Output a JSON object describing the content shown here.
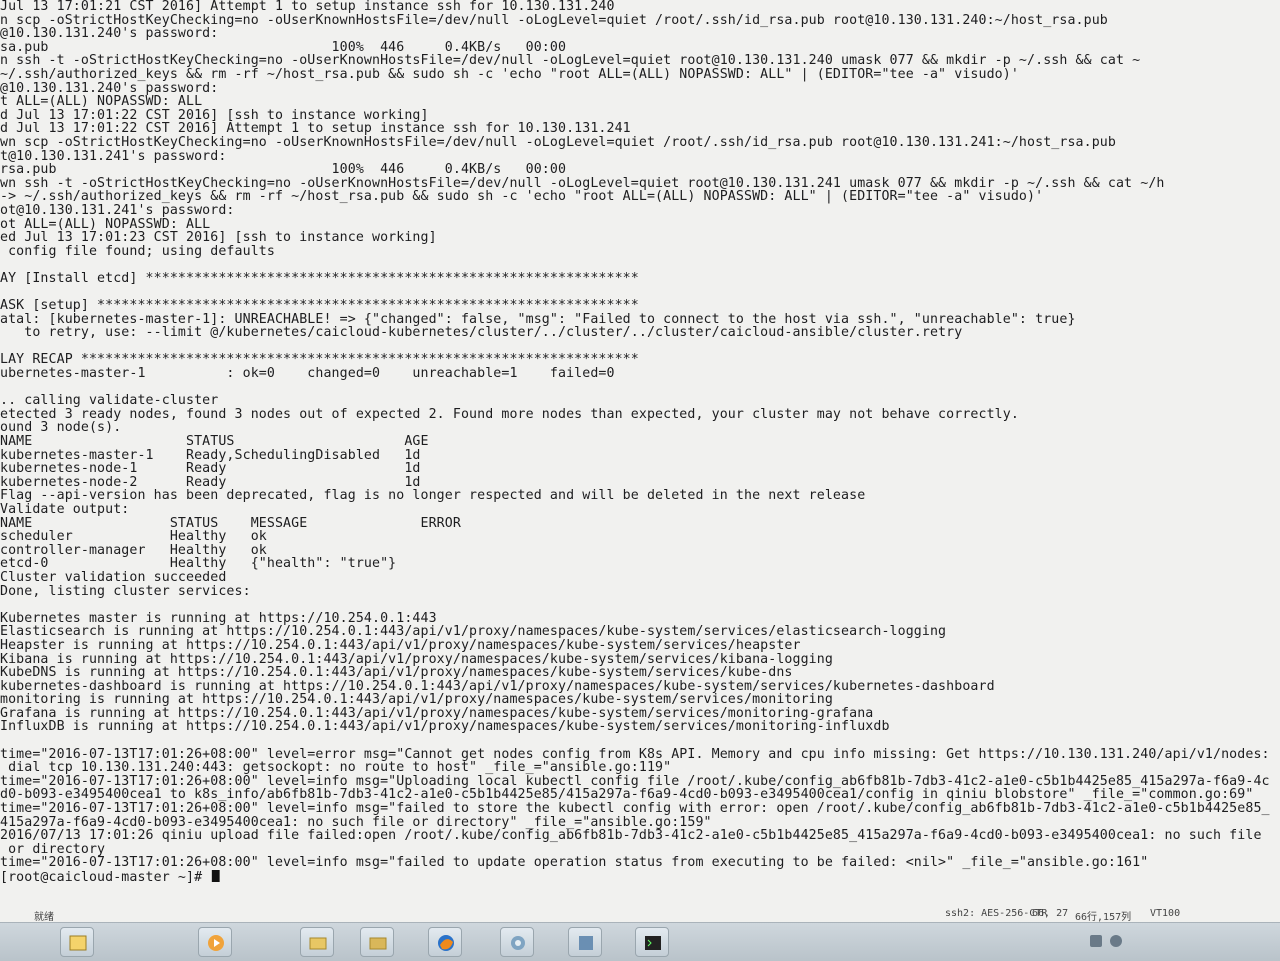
{
  "terminal": {
    "lines": [
      "Jul 13 17:01:21 CST 2016] Attempt 1 to setup instance ssh for 10.130.131.240",
      "n scp -oStrictHostKeyChecking=no -oUserKnownHostsFile=/dev/null -oLogLevel=quiet /root/.ssh/id_rsa.pub root@10.130.131.240:~/host_rsa.pub",
      "@10.130.131.240's password:",
      "sa.pub                                   100%  446     0.4KB/s   00:00",
      "n ssh -t -oStrictHostKeyChecking=no -oUserKnownHostsFile=/dev/null -oLogLevel=quiet root@10.130.131.240 umask 077 && mkdir -p ~/.ssh && cat ~",
      "~/.ssh/authorized_keys && rm -rf ~/host_rsa.pub && sudo sh -c 'echo \"root ALL=(ALL) NOPASSWD: ALL\" | (EDITOR=\"tee -a\" visudo)'",
      "@10.130.131.240's password:",
      "t ALL=(ALL) NOPASSWD: ALL",
      "d Jul 13 17:01:22 CST 2016] [ssh to instance working]",
      "d Jul 13 17:01:22 CST 2016] Attempt 1 to setup instance ssh for 10.130.131.241",
      "wn scp -oStrictHostKeyChecking=no -oUserKnownHostsFile=/dev/null -oLogLevel=quiet /root/.ssh/id_rsa.pub root@10.130.131.241:~/host_rsa.pub",
      "t@10.130.131.241's password:",
      "rsa.pub                                  100%  446     0.4KB/s   00:00",
      "wn ssh -t -oStrictHostKeyChecking=no -oUserKnownHostsFile=/dev/null -oLogLevel=quiet root@10.130.131.241 umask 077 && mkdir -p ~/.ssh && cat ~/h",
      "-> ~/.ssh/authorized_keys && rm -rf ~/host_rsa.pub && sudo sh -c 'echo \"root ALL=(ALL) NOPASSWD: ALL\" | (EDITOR=\"tee -a\" visudo)'",
      "ot@10.130.131.241's password:",
      "ot ALL=(ALL) NOPASSWD: ALL",
      "ed Jul 13 17:01:23 CST 2016] [ssh to instance working]",
      " config file found; using defaults",
      "",
      "AY [Install etcd] *************************************************************",
      "",
      "ASK [setup] *******************************************************************",
      "atal: [kubernetes-master-1]: UNREACHABLE! => {\"changed\": false, \"msg\": \"Failed to connect to the host via ssh.\", \"unreachable\": true}",
      "   to retry, use: --limit @/kubernetes/caicloud-kubernetes/cluster/../cluster/../cluster/caicloud-ansible/cluster.retry",
      "",
      "LAY RECAP *********************************************************************",
      "ubernetes-master-1          : ok=0    changed=0    unreachable=1    failed=0",
      "",
      ".. calling validate-cluster",
      "etected 3 ready nodes, found 3 nodes out of expected 2. Found more nodes than expected, your cluster may not behave correctly.",
      "ound 3 node(s).",
      "NAME                   STATUS                     AGE",
      "kubernetes-master-1    Ready,SchedulingDisabled   1d",
      "kubernetes-node-1      Ready                      1d",
      "kubernetes-node-2      Ready                      1d",
      "Flag --api-version has been deprecated, flag is no longer respected and will be deleted in the next release",
      "Validate output:",
      "NAME                 STATUS    MESSAGE              ERROR",
      "scheduler            Healthy   ok",
      "controller-manager   Healthy   ok",
      "etcd-0               Healthy   {\"health\": \"true\"}",
      "Cluster validation succeeded",
      "Done, listing cluster services:",
      "",
      "Kubernetes master is running at https://10.254.0.1:443",
      "Elasticsearch is running at https://10.254.0.1:443/api/v1/proxy/namespaces/kube-system/services/elasticsearch-logging",
      "Heapster is running at https://10.254.0.1:443/api/v1/proxy/namespaces/kube-system/services/heapster",
      "Kibana is running at https://10.254.0.1:443/api/v1/proxy/namespaces/kube-system/services/kibana-logging",
      "KubeDNS is running at https://10.254.0.1:443/api/v1/proxy/namespaces/kube-system/services/kube-dns",
      "kubernetes-dashboard is running at https://10.254.0.1:443/api/v1/proxy/namespaces/kube-system/services/kubernetes-dashboard",
      "monitoring is running at https://10.254.0.1:443/api/v1/proxy/namespaces/kube-system/services/monitoring",
      "Grafana is running at https://10.254.0.1:443/api/v1/proxy/namespaces/kube-system/services/monitoring-grafana",
      "InfluxDB is running at https://10.254.0.1:443/api/v1/proxy/namespaces/kube-system/services/monitoring-influxdb",
      "",
      "time=\"2016-07-13T17:01:26+08:00\" level=error msg=\"Cannot get nodes config from K8s API. Memory and cpu info missing: Get https://10.130.131.240/api/v1/nodes:",
      " dial tcp 10.130.131.240:443: getsockopt: no route to host\" _file_=\"ansible.go:119\"",
      "time=\"2016-07-13T17:01:26+08:00\" level=info msg=\"Uploading local kubectl config file /root/.kube/config_ab6fb81b-7db3-41c2-a1e0-c5b1b4425e85_415a297a-f6a9-4c",
      "d0-b093-e3495400cea1 to k8s_info/ab6fb81b-7db3-41c2-a1e0-c5b1b4425e85/415a297a-f6a9-4cd0-b093-e3495400cea1/config in qiniu blobstore\" _file_=\"common.go:69\"",
      "time=\"2016-07-13T17:01:26+08:00\" level=info msg=\"failed to store the kubectl config with error: open /root/.kube/config_ab6fb81b-7db3-41c2-a1e0-c5b1b4425e85_",
      "415a297a-f6a9-4cd0-b093-e3495400cea1: no such file or directory\" _file_=\"ansible.go:159\"",
      "2016/07/13 17:01:26 qiniu upload file failed:open /root/.kube/config_ab6fb81b-7db3-41c2-a1e0-c5b1b4425e85_415a297a-f6a9-4cd0-b093-e3495400cea1: no such file",
      " or directory",
      "time=\"2016-07-13T17:01:26+08:00\" level=info msg=\"failed to update operation status from executing to be failed: <nil>\" _file_=\"ansible.go:161\""
    ],
    "prompt": "[root@caicloud-master ~]# "
  },
  "statusbar": {
    "left": "就绪",
    "encryption": "ssh2: AES-256-CTR",
    "position": "66, 27",
    "size": "66行,157列",
    "term": "VT100"
  },
  "taskbar": {
    "icons": [
      "start-orb-icon",
      "explorer-icon",
      "media-player-icon",
      "folder-icon",
      "firefox-icon",
      "settings-icon",
      "app-icon",
      "terminal-icon"
    ]
  }
}
